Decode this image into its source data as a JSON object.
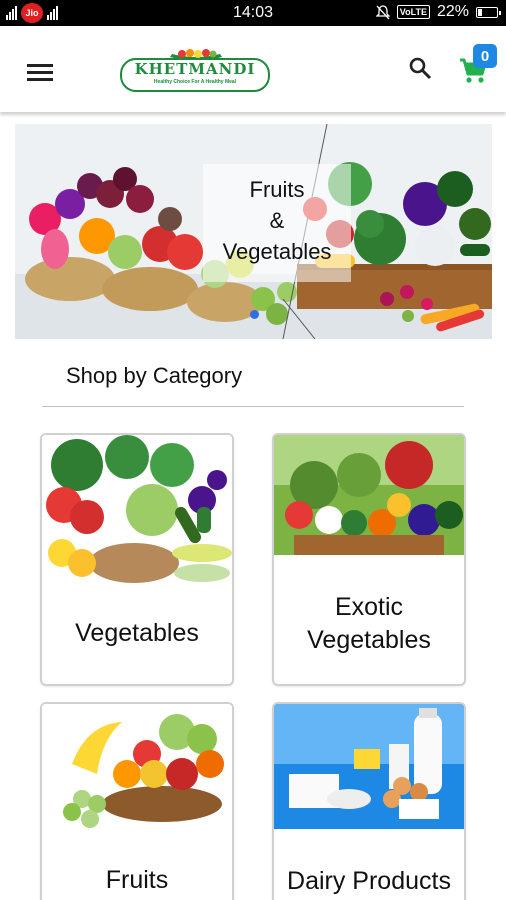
{
  "status_bar": {
    "carrier": "Jio",
    "time": "14:03",
    "network": "VoLTE",
    "battery": "22%",
    "battery_level": 0.22
  },
  "header": {
    "logo_text": "KHETMANDI",
    "logo_tagline": "Healthy Choice For A Healthy Meal",
    "cart_count": "0",
    "icons": {
      "menu": "menu-icon",
      "search": "search-icon",
      "cart": "cart-icon"
    },
    "colors": {
      "brand_green": "#1e8a3c",
      "cart_green": "#22b14c",
      "badge_blue": "#1e88e5"
    }
  },
  "banner": {
    "caption_line1": "Fruits",
    "caption_line2": "&",
    "caption_line3": "Vegetables",
    "active_slide": 1
  },
  "section": {
    "title": "Shop by Category"
  },
  "categories": [
    {
      "label": "Vegetables"
    },
    {
      "label": "Exotic Vegetables"
    },
    {
      "label": "Fruits"
    },
    {
      "label": "Dairy Products"
    }
  ]
}
